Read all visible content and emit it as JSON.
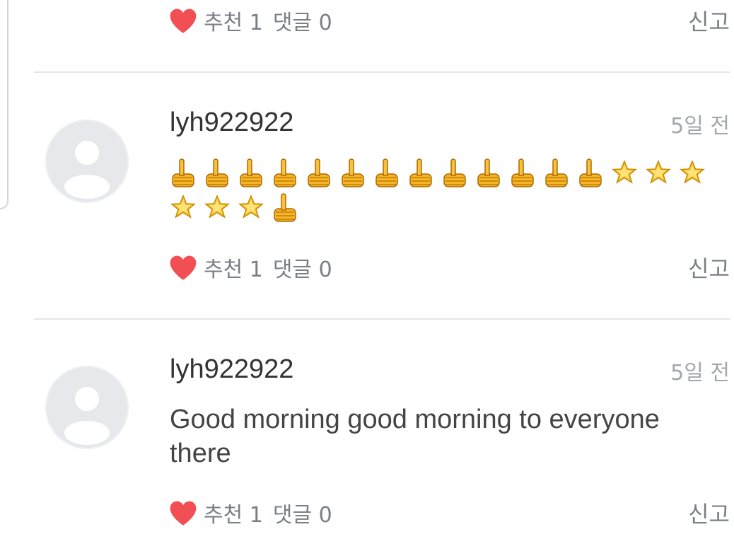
{
  "colors": {
    "heart": "#f24f54",
    "meta_gray": "#7a7f86",
    "time_gray": "#a2a6ab",
    "divider": "#e6e6e6",
    "avatar_bg": "#e6e8ec"
  },
  "top_actions": {
    "recommend": "추천 1",
    "comments": "댓글 0",
    "report": "신고"
  },
  "comments": [
    {
      "username": "lyh922922",
      "time": "5일 전",
      "emoji_lines": [
        [
          "thumbs-up",
          "thumbs-up",
          "thumbs-up",
          "thumbs-up",
          "thumbs-up",
          "thumbs-up",
          "thumbs-up",
          "thumbs-up",
          "thumbs-up",
          "thumbs-up",
          "thumbs-up",
          "thumbs-up",
          "thumbs-up",
          "star",
          "star",
          "star"
        ],
        [
          "star",
          "star",
          "star",
          "thumbs-up"
        ]
      ],
      "recommend": "추천 1",
      "comments_count": "댓글 0",
      "report": "신고"
    },
    {
      "username": "lyh922922",
      "time": "5일 전",
      "text": "Good morning good morning to everyone there",
      "recommend": "추천 1",
      "comments_count": "댓글 0",
      "report": "신고"
    }
  ]
}
